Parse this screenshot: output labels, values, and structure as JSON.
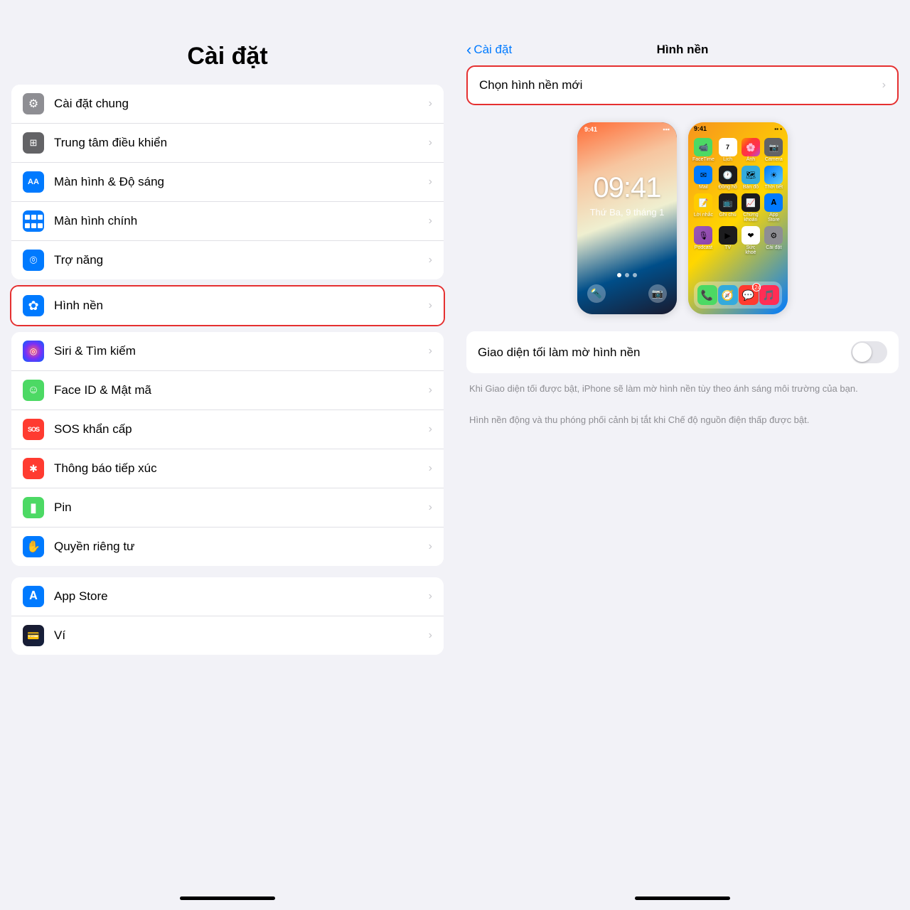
{
  "left": {
    "title": "Cài đặt",
    "group1": [
      {
        "id": "general",
        "label": "Cài đặt chung",
        "iconClass": "icon-gray",
        "iconSymbol": "⚙"
      },
      {
        "id": "control-center",
        "label": "Trung tâm điều khiển",
        "iconClass": "icon-gray2",
        "iconSymbol": "⊞"
      },
      {
        "id": "display",
        "label": "Màn hình & Độ sáng",
        "iconClass": "icon-blue",
        "iconSymbol": "𝐀𝐀"
      },
      {
        "id": "home-screen",
        "label": "Màn hình chính",
        "iconClass": "icon-blue2",
        "iconSymbol": "⊞"
      },
      {
        "id": "accessibility",
        "label": "Trợ năng",
        "iconClass": "icon-blue3",
        "iconSymbol": "♿"
      }
    ],
    "highlighted_item": {
      "id": "wallpaper",
      "label": "Hình nền",
      "iconClass": "icon-flower",
      "iconSymbol": "✿"
    },
    "group2": [
      {
        "id": "siri",
        "label": "Siri & Tìm kiếm",
        "iconClass": "icon-siri",
        "iconSymbol": "◎"
      },
      {
        "id": "faceid",
        "label": "Face ID & Mật mã",
        "iconClass": "icon-faceid",
        "iconSymbol": "☺"
      },
      {
        "id": "sos",
        "label": "SOS khẩn cấp",
        "iconClass": "icon-sos",
        "iconSymbol": "SOS"
      },
      {
        "id": "contact-tracing",
        "label": "Thông báo tiếp xúc",
        "iconClass": "icon-contact",
        "iconSymbol": "✱"
      },
      {
        "id": "battery",
        "label": "Pin",
        "iconClass": "icon-battery",
        "iconSymbol": "▮"
      },
      {
        "id": "privacy",
        "label": "Quyền riêng tư",
        "iconClass": "icon-privacy",
        "iconSymbol": "✋"
      }
    ],
    "group3": [
      {
        "id": "appstore",
        "label": "App Store",
        "iconClass": "icon-appstore",
        "iconSymbol": "𝐀"
      },
      {
        "id": "wallet",
        "label": "Ví",
        "iconClass": "icon-wallet",
        "iconSymbol": "💳"
      }
    ]
  },
  "right": {
    "back_label": "Cài đặt",
    "title": "Hình nền",
    "choose_btn": "Chọn hình nền mới",
    "lock_time": "09:41",
    "lock_date": "Thứ Ba, 9 tháng 1",
    "home_time": "9:41",
    "toggle_label": "Giao diện tối làm mờ hình nền",
    "toggle_state": false,
    "description1": "Khi Giao diện tối được bật, iPhone sẽ làm mờ hình nền tùy theo ánh sáng môi trường của bạn.",
    "description2": "Hình nền động và thu phóng phối cảnh bị tắt khi Chế độ nguồn điện thấp được bật."
  }
}
